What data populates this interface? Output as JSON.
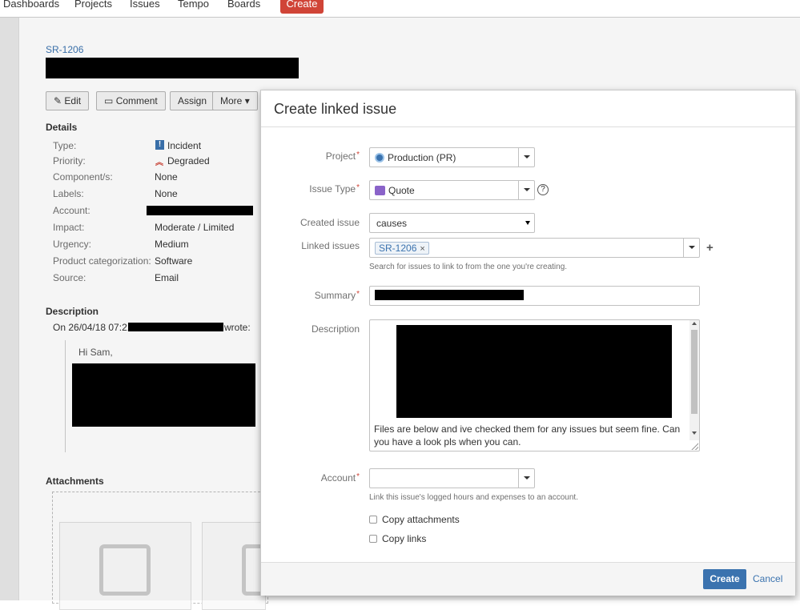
{
  "topnav": {
    "items": [
      "Dashboards",
      "Projects",
      "Issues",
      "Tempo",
      "Boards"
    ],
    "create_label": "Create"
  },
  "issue": {
    "key": "SR-1206",
    "toolbar": {
      "edit": "Edit",
      "comment": "Comment",
      "assign": "Assign",
      "more": "More"
    },
    "details_title": "Details",
    "details": {
      "type_label": "Type:",
      "type_value": "Incident",
      "priority_label": "Priority:",
      "priority_value": "Degraded",
      "components_label": "Component/s:",
      "components_value": "None",
      "labels_label": "Labels:",
      "labels_value": "None",
      "account_label": "Account:",
      "impact_label": "Impact:",
      "impact_value": "Moderate / Limited",
      "urgency_label": "Urgency:",
      "urgency_value": "Medium",
      "category_label": "Product categorization:",
      "category_value": "Software",
      "source_label": "Source:",
      "source_value": "Email"
    },
    "description_title": "Description",
    "description_prefix": "On 26/04/18 07:21",
    "description_wrote": "wrote:",
    "greeting": "Hi Sam,",
    "attachments_title": "Attachments"
  },
  "dialog": {
    "title": "Create linked issue",
    "project_label": "Project",
    "project_value": "Production (PR)",
    "issue_type_label": "Issue Type",
    "issue_type_value": "Quote",
    "help_glyph": "?",
    "created_issue_label": "Created issue",
    "created_issue_value": "causes",
    "linked_issues_label": "Linked issues",
    "linked_issue_lozenge": "SR-1206",
    "linked_remove_glyph": "×",
    "add_glyph": "+",
    "linked_hint": "Search for issues to link to from the one you're creating.",
    "summary_label": "Summary",
    "description_label": "Description",
    "description_visible_text": "Files are below and ive checked them for any issues but seem fine. Can you have a look pls when you can.",
    "account_label": "Account",
    "account_hint": "Link this issue's logged hours and expenses to an account.",
    "copy_attachments_label": "Copy attachments",
    "copy_links_label": "Copy links",
    "required_marker": "*",
    "create_label": "Create",
    "cancel_label": "Cancel"
  },
  "colors": {
    "accent": "#3b73af",
    "create_nav": "#d04437",
    "required": "#d04437"
  }
}
